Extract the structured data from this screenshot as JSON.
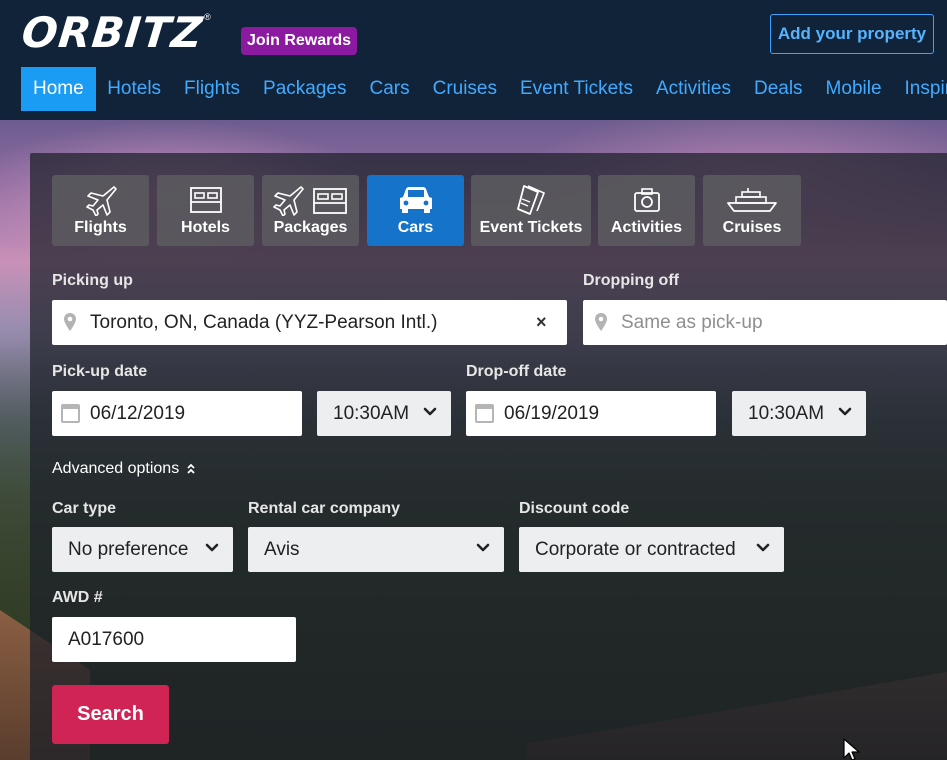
{
  "header": {
    "logo_text": "ORBITZ",
    "logo_tm": "®",
    "rewards_label": "Join Rewards",
    "add_property_label": "Add your property"
  },
  "nav": {
    "items": [
      "Home",
      "Hotels",
      "Flights",
      "Packages",
      "Cars",
      "Cruises",
      "Event Tickets",
      "Activities",
      "Deals",
      "Mobile",
      "Inspiration"
    ],
    "active": "Home"
  },
  "tabs": {
    "flights": "Flights",
    "hotels": "Hotels",
    "packages": "Packages",
    "cars": "Cars",
    "event_tickets": "Event Tickets",
    "activities": "Activities",
    "cruises": "Cruises",
    "active": "Cars"
  },
  "form": {
    "pickup_label": "Picking up",
    "pickup_value": "Toronto, ON, Canada (YYZ-Pearson Intl.)",
    "clear_icon": "×",
    "dropoff_label": "Dropping off",
    "dropoff_placeholder": "Same as pick-up",
    "pickup_date_label": "Pick-up date",
    "pickup_date": "06/12/2019",
    "pickup_time": "10:30AM",
    "dropoff_date_label": "Drop-off date",
    "dropoff_date": "06/19/2019",
    "dropoff_time": "10:30AM",
    "advanced_label": "Advanced options",
    "car_type_label": "Car type",
    "car_type_value": "No preference",
    "company_label": "Rental car company",
    "company_value": "Avis",
    "discount_label": "Discount code",
    "discount_value": "Corporate or contracted",
    "awd_label": "AWD #",
    "awd_value": "A017600",
    "search_label": "Search"
  },
  "colors": {
    "header_bg": "#112339",
    "nav_link": "#41aaff",
    "nav_active_bg": "#1a9cf5",
    "rewards_bg": "#8c1aa0",
    "tab_active_bg": "#1573c9",
    "search_bg": "#d02455"
  }
}
